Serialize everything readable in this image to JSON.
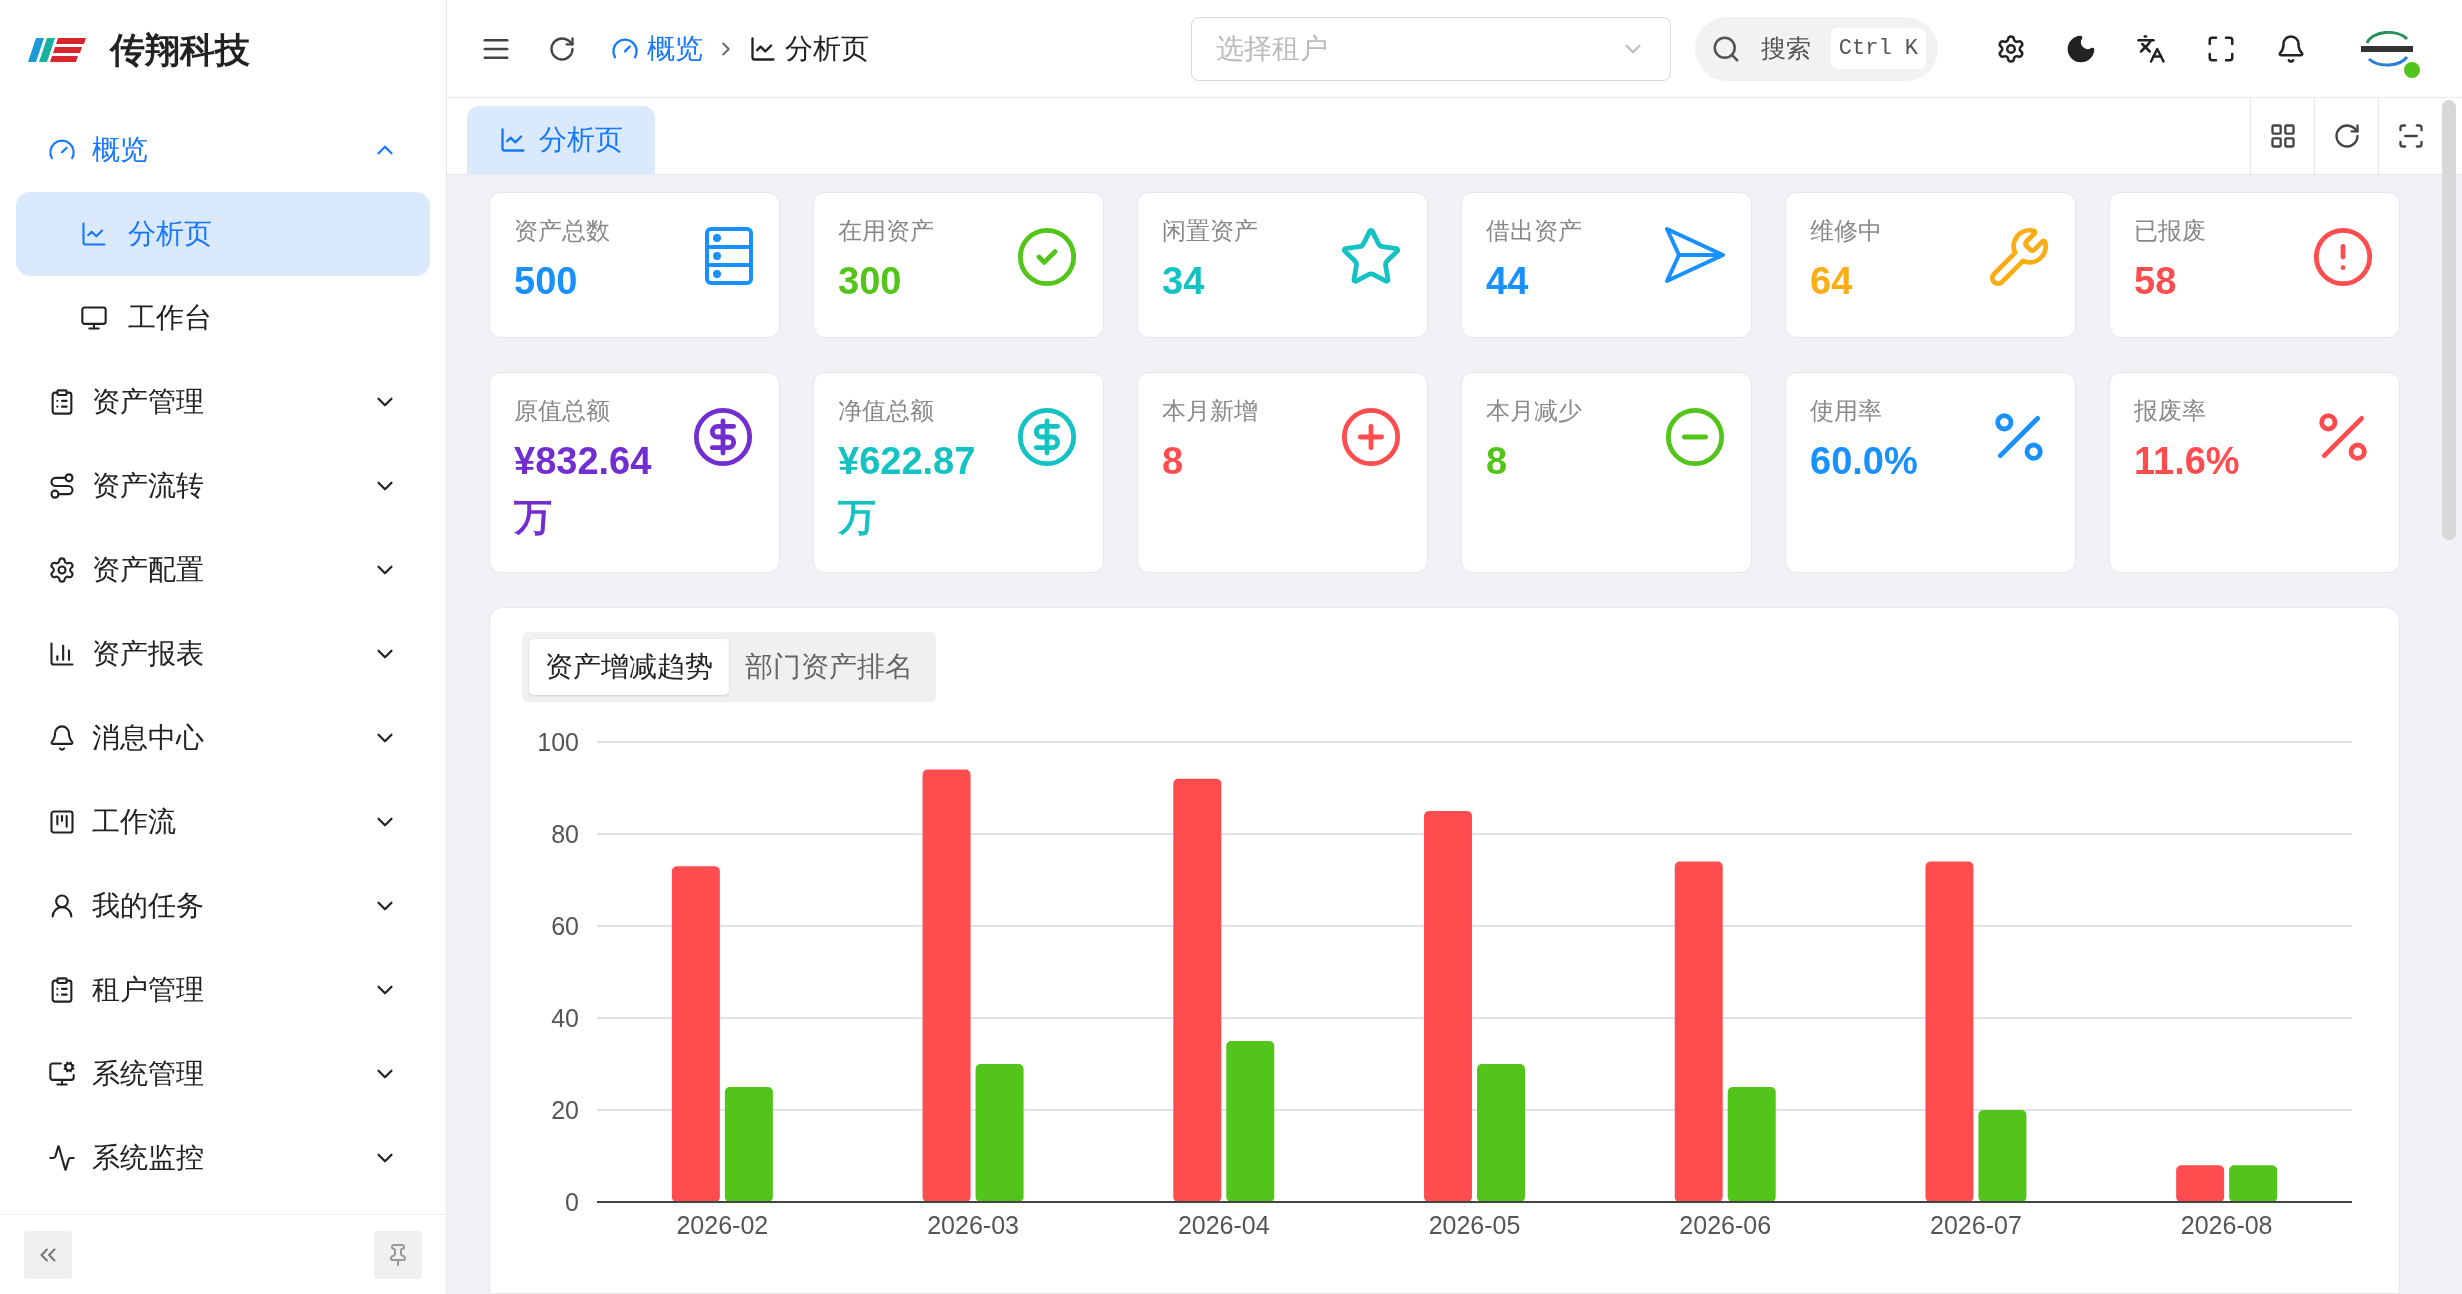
{
  "brand": {
    "name": "传翔科技"
  },
  "sidebar": {
    "items": [
      {
        "label": "概览",
        "expanded": true,
        "selected": false,
        "children": [
          {
            "label": "分析页",
            "selected": true
          },
          {
            "label": "工作台",
            "selected": false
          }
        ]
      },
      {
        "label": "资产管理",
        "expanded": false,
        "selected": false
      },
      {
        "label": "资产流转",
        "expanded": false,
        "selected": false
      },
      {
        "label": "资产配置",
        "expanded": false,
        "selected": false
      },
      {
        "label": "资产报表",
        "expanded": false,
        "selected": false
      },
      {
        "label": "消息中心",
        "expanded": false,
        "selected": false
      },
      {
        "label": "工作流",
        "expanded": false,
        "selected": false
      },
      {
        "label": "我的任务",
        "expanded": false,
        "selected": false
      },
      {
        "label": "租户管理",
        "expanded": false,
        "selected": false
      },
      {
        "label": "系统管理",
        "expanded": false,
        "selected": false
      },
      {
        "label": "系统监控",
        "expanded": false,
        "selected": false
      }
    ]
  },
  "header": {
    "breadcrumb": [
      "概览",
      "分析页"
    ],
    "tenant_select": {
      "placeholder": "选择租户"
    },
    "search": {
      "label": "搜索",
      "shortcut": "Ctrl K"
    },
    "online": true
  },
  "page_tabs": [
    {
      "label": "分析页",
      "selected": true
    }
  ],
  "stats": [
    {
      "label": "资产总数",
      "value": "500",
      "color": "#1890ff",
      "kind": "list"
    },
    {
      "label": "在用资产",
      "value": "300",
      "color": "#52c41a",
      "kind": "check"
    },
    {
      "label": "闲置资产",
      "value": "34",
      "color": "#13c2c2",
      "kind": "star"
    },
    {
      "label": "借出资产",
      "value": "44",
      "color": "#1890ff",
      "kind": "send"
    },
    {
      "label": "维修中",
      "value": "64",
      "color": "#faad14",
      "kind": "wrench"
    },
    {
      "label": "已报废",
      "value": "58",
      "color": "#ff4d4f",
      "kind": "alert"
    },
    {
      "label": "原值总额",
      "value": "¥832.64万",
      "color": "#722ed1",
      "kind": "dollar"
    },
    {
      "label": "净值总额",
      "value": "¥622.87万",
      "color": "#13c2c2",
      "kind": "dollar"
    },
    {
      "label": "本月新增",
      "value": "8",
      "color": "#ff4d4f",
      "kind": "plus"
    },
    {
      "label": "本月减少",
      "value": "8",
      "color": "#52c41a",
      "kind": "minus"
    },
    {
      "label": "使用率",
      "value": "60.0%",
      "color": "#1890ff",
      "kind": "percent"
    },
    {
      "label": "报废率",
      "value": "11.6%",
      "color": "#ff4d4f",
      "kind": "percent"
    }
  ],
  "chart_tabs": [
    {
      "label": "资产增减趋势",
      "selected": true
    },
    {
      "label": "部门资产排名",
      "selected": false
    }
  ],
  "chart_data": {
    "type": "bar",
    "categories": [
      "2026-02",
      "2026-03",
      "2026-04",
      "2026-05",
      "2026-06",
      "2026-07",
      "2026-08"
    ],
    "series": [
      {
        "color": "#ff4d4f",
        "values": [
          73,
          94,
          92,
          85,
          74,
          74,
          8
        ]
      },
      {
        "color": "#52c41a",
        "values": [
          25,
          30,
          35,
          30,
          25,
          20,
          8
        ]
      }
    ],
    "grid": true,
    "ylim": [
      0,
      100
    ],
    "yticks": [
      0,
      20,
      40,
      60,
      80,
      100
    ]
  }
}
